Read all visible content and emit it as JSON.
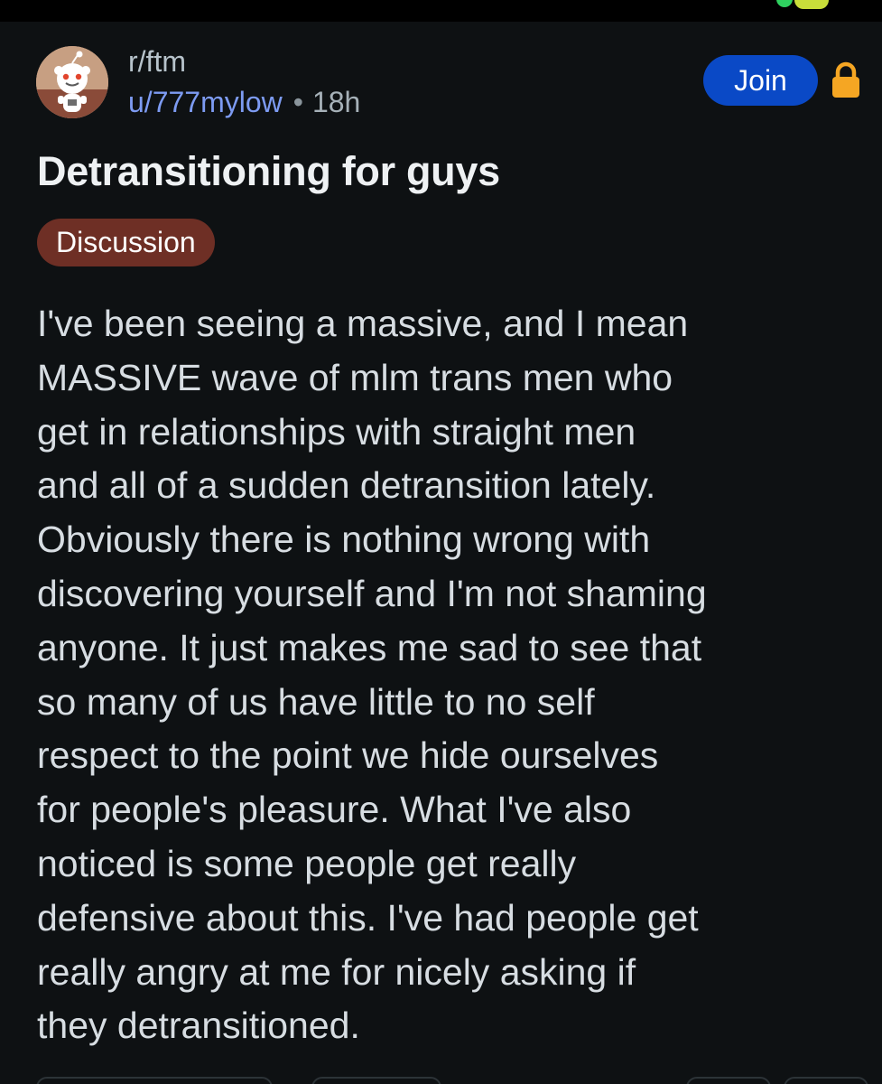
{
  "header": {
    "subreddit": "r/ftm",
    "username": "u/777mylow",
    "separator": "•",
    "age": "18h",
    "join_label": "Join",
    "avatar_icon": "reddit-snoo-avatar-icon",
    "lock_icon": "lock-icon"
  },
  "post": {
    "title": "Detransitioning for guys",
    "flair": "Discussion",
    "body_lines": [
      "I've been seeing a massive, and I mean",
      "MASSIVE wave of mlm trans men who",
      "get in relationships with straight men",
      "and all of a sudden detransition lately.",
      "Obviously there is nothing wrong with",
      "discovering yourself and I'm not shaming",
      "anyone. It just makes me sad to see that",
      "so many of us have little to no self",
      "respect to the point we hide ourselves",
      "for people's pleasure. What I've also",
      "noticed is some people get really",
      "defensive about this. I've had people get",
      "really angry at me for nicely asking if",
      "they detransitioned."
    ]
  },
  "colors": {
    "background": "#0e1113",
    "join_button": "#0a49c6",
    "flair_background": "#6e2f25",
    "username": "#7d9bf2",
    "lock": "#f5a623"
  }
}
